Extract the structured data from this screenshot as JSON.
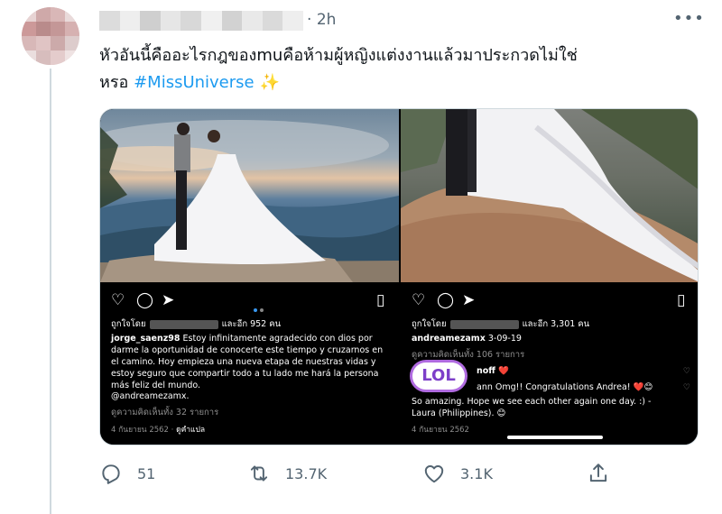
{
  "tweet": {
    "time": "2h",
    "more_icon": "more-horizontal-icon",
    "text": "หัวอันนี้คืออะไรกฎของmuคือห้ามผู้หญิงแต่งงานแล้วมาประกวดไม่ใช่หรอ",
    "hashtag": "#MissUniverse",
    "emoji": "✨"
  },
  "media": {
    "left": {
      "liked_prefix": "ถูกใจโดย",
      "liked_suffix": "และอีก 952 คน",
      "username": "jorge_saenz98",
      "caption": "Estoy infinitamente agradecido con dios por darme la oportunidad de conocerte este tiempo y cruzarnos en el camino. Hoy empieza una nueva etapa de nuestras vidas y estoy seguro que compartir todo a tu lado me hará la persona más feliz del mundo.",
      "mention": "@andreamezamx.",
      "comments": "ดูความคิดเห็นทั้ง 32 รายการ",
      "date": "4 กันยายน 2562",
      "translate": "ดูคำแปล"
    },
    "right": {
      "liked_prefix": "ถูกใจโดย",
      "liked_suffix": "และอีก 3,301 คน",
      "username": "andreamezamx",
      "caption": "3-09-19",
      "comments": "ดูความคิดเห็นทั้ง 106 รายการ",
      "comment1_user": "noff",
      "comment1_emoji": "❤️",
      "comment2": "ann Omg!! Congratulations Andrea! ❤️😊",
      "comment3": "So amazing. Hope we see each other again one day. :) - Laura (Philippines).",
      "comment3_emoji": "😊",
      "date": "4 กันยายน 2562",
      "sticker": "LOL"
    }
  },
  "actions": {
    "replies": "51",
    "retweets": "13.7K",
    "likes": "3.1K"
  }
}
